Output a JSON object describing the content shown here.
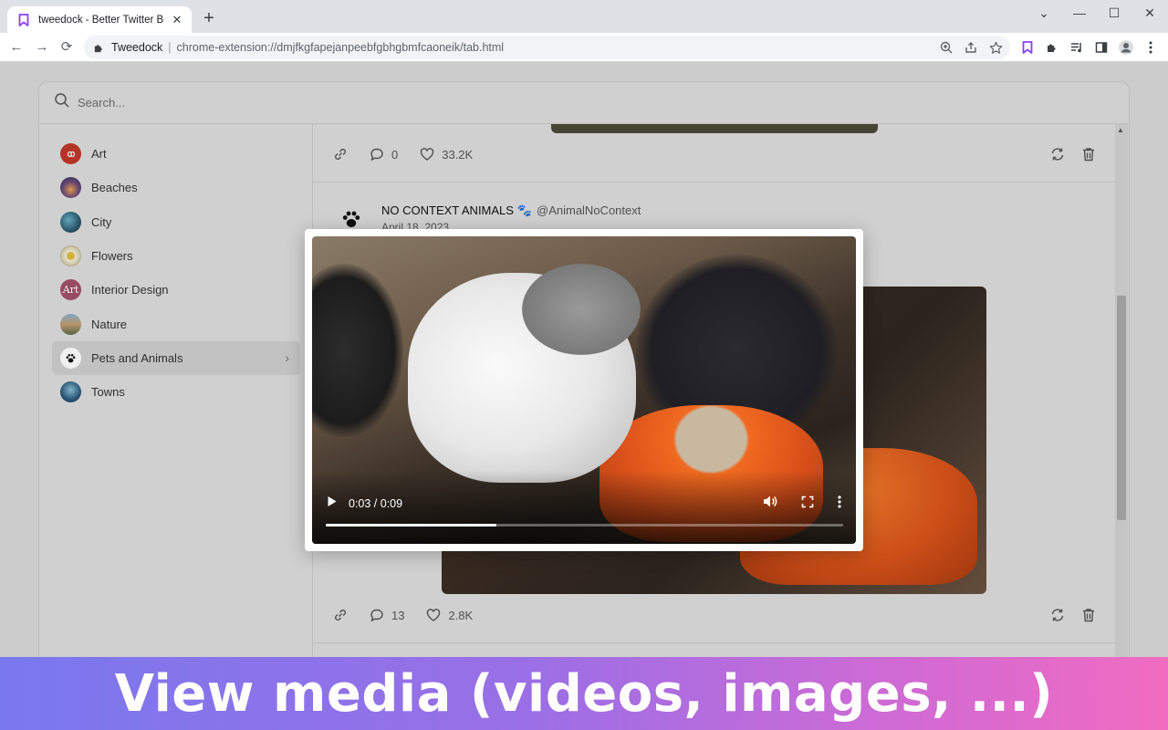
{
  "browser": {
    "tab_title": "tweedock - Better Twitter Bookm",
    "tab_close": "✕",
    "new_tab": "+",
    "win_minimize": "—",
    "win_maximize": "☐",
    "win_close": "✕",
    "win_tabsearch": "⌄",
    "omnibox_site": "Tweedock",
    "omnibox_separator": "|",
    "url": "chrome-extension://dmjfkgfapejanpeebfgbhgbmfcaoneik/tab.html"
  },
  "search": {
    "placeholder": "Search..."
  },
  "sidebar": {
    "items": [
      {
        "label": "Art",
        "avatar_color": "#c0392b"
      },
      {
        "label": "Beaches",
        "avatar_color": "#3a3f6b"
      },
      {
        "label": "City",
        "avatar_color": "#2d5a6e"
      },
      {
        "label": "Flowers",
        "avatar_color": "#8a7a50"
      },
      {
        "label": "Interior Design",
        "avatar_color": "#a0506a"
      },
      {
        "label": "Nature",
        "avatar_color": "#5a7a8a"
      },
      {
        "label": "Pets and Animals",
        "avatar_color": "#ffffff"
      },
      {
        "label": "Towns",
        "avatar_color": "#2a5a7a"
      }
    ],
    "art_avatar_text": "Art",
    "active_chevron": "›"
  },
  "tweets": [
    {
      "replies": "0",
      "likes": "33.2K"
    },
    {
      "author_name": "NO CONTEXT ANIMALS 🐾",
      "handle": "@AnimalNoContext",
      "date": "April 18, 2023",
      "replies": "13",
      "likes": "2.8K"
    }
  ],
  "video": {
    "time": "0:03 / 0:09",
    "progress": 0.33
  },
  "banner": {
    "text": "View media (videos, images, ...)"
  },
  "colors": {
    "accent": "#8a3ffc",
    "banner_start": "#7a78ee",
    "banner_end": "#f06cc0"
  }
}
